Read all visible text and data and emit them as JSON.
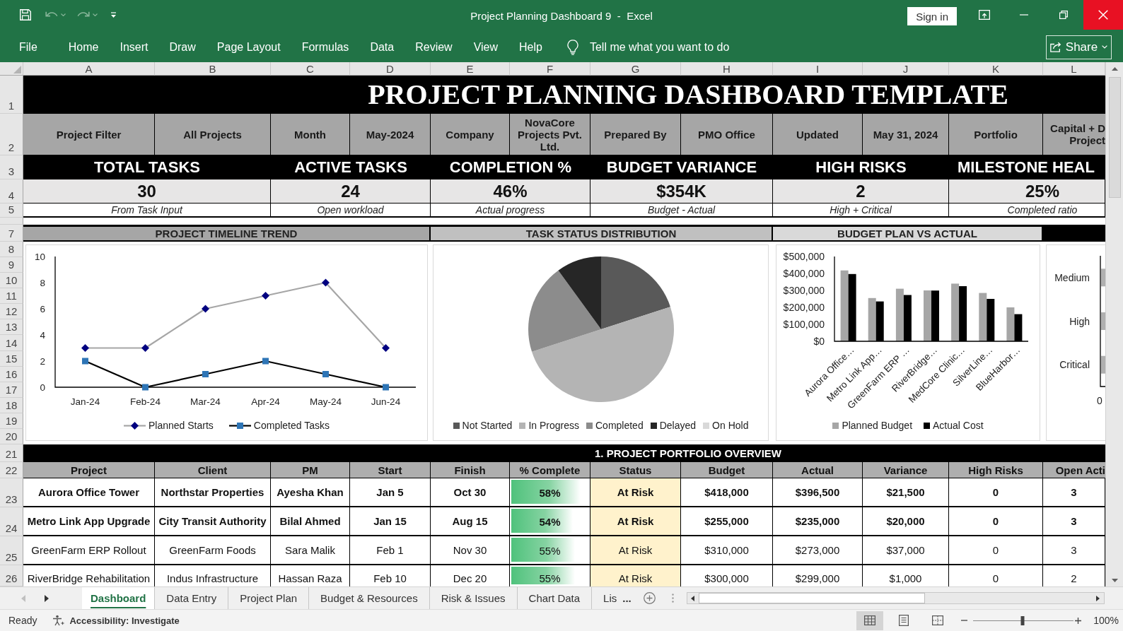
{
  "window": {
    "quick_access": [
      {
        "kind": "save",
        "disabled": false
      },
      {
        "kind": "undo",
        "disabled": true
      },
      {
        "kind": "redo",
        "disabled": true
      },
      {
        "kind": "customize",
        "disabled": false
      }
    ],
    "title": "Project Planning Dashboard 9  -  Excel",
    "sign_in": "Sign in"
  },
  "ribbon": {
    "tabs": [
      "File",
      "Home",
      "Insert",
      "Draw",
      "Page Layout",
      "Formulas",
      "Data",
      "Review",
      "View",
      "Help"
    ],
    "tell_me": {
      "placeholder": "Tell me what you want to do"
    },
    "share": "Share"
  },
  "sheet": {
    "columns": [
      "A",
      "B",
      "C",
      "D",
      "E",
      "F",
      "G",
      "H",
      "I",
      "J",
      "K",
      "L"
    ],
    "row_numbers": [
      "1",
      "2",
      "3",
      "4",
      "5",
      "7",
      "8",
      "9",
      "10",
      "11",
      "12",
      "13",
      "14",
      "15",
      "16",
      "17",
      "18",
      "19",
      "20",
      "21",
      "22",
      "23",
      "24",
      "25",
      "26"
    ],
    "title": "PROJECT PLANNING DASHBOARD TEMPLATE",
    "filters": [
      {
        "label": "Project Filter",
        "value": "All Projects"
      },
      {
        "label": "Month",
        "value": "May-2024"
      },
      {
        "label": "Company",
        "value": "NovaCore Projects Pvt. Ltd."
      },
      {
        "label": "Prepared By",
        "value": "PMO Office"
      },
      {
        "label": "Updated",
        "value": "May 31, 2024"
      },
      {
        "label": "Portfolio",
        "value": "Capital + D Project"
      }
    ],
    "kpis": [
      {
        "title": "TOTAL TASKS",
        "value": "30",
        "note": "From Task Input"
      },
      {
        "title": "ACTIVE TASKS",
        "value": "24",
        "note": "Open workload"
      },
      {
        "title": "COMPLETION %",
        "value": "46%",
        "note": "Actual progress"
      },
      {
        "title": "BUDGET VARIANCE",
        "value": "$354K",
        "note": "Budget - Actual"
      },
      {
        "title": "HIGH RISKS",
        "value": "2",
        "note": "High + Critical"
      },
      {
        "title": "MILESTONE HEAL",
        "value": "25%",
        "note": "Completed ratio"
      }
    ],
    "panels": [
      {
        "kind": "chart",
        "title": "PROJECT TIMELINE TREND",
        "chart_data": [
          {
            "type": "line",
            "categories": [
              "Jan-24",
              "Feb-24",
              "Mar-24",
              "Apr-24",
              "May-24",
              "Jun-24"
            ],
            "ylim": [
              0,
              10
            ],
            "yticks": [
              0,
              2,
              4,
              6,
              8,
              10
            ],
            "legend": "bottom",
            "series": [
              {
                "name": "Planned Starts",
                "color": "#a6a6a6",
                "marker": "diamond",
                "values": [
                  3,
                  3,
                  6,
                  7,
                  8,
                  3
                ]
              },
              {
                "name": "Completed Tasks",
                "color": "#000000",
                "marker": "square",
                "values": [
                  2,
                  0,
                  1,
                  2,
                  1,
                  0
                ]
              }
            ]
          }
        ]
      },
      {
        "kind": "pie",
        "title": "TASK STATUS DISTRIBUTION",
        "legend": [
          {
            "label": "Not Started",
            "color": "#595959"
          },
          {
            "label": "In Progress",
            "color": "#b4b4b4"
          },
          {
            "label": "Completed",
            "color": "#8c8c8c"
          },
          {
            "label": "Delayed",
            "color": "#262626"
          },
          {
            "label": "On Hold",
            "color": "#d9d9d9"
          }
        ]
      },
      {
        "kind": "chart",
        "title": "BUDGET PLAN VS ACTUAL",
        "chart_data": [
          {
            "type": "bar",
            "categories": [
              "Aurora Office…",
              "Metro Link App…",
              "GreenFarm ERP …",
              "RiverBridge…",
              "MedCore Clinic…",
              "SilverLine…",
              "BlueHarbor…"
            ],
            "ylim": [
              0,
              500000
            ],
            "yticks": [
              {
                "value": 0,
                "label": "$0"
              },
              {
                "value": 100000,
                "label": "$100,000"
              },
              {
                "value": 200000,
                "label": "$200,000"
              },
              {
                "value": 300000,
                "label": "$300,000"
              },
              {
                "value": 400000,
                "label": "$400,000"
              },
              {
                "value": 500000,
                "label": "$500,000"
              }
            ],
            "legend": "bottom",
            "series": [
              {
                "name": "Planned Budget",
                "color": "#a6a6a6",
                "values": [
                  418000,
                  255000,
                  310000,
                  300000,
                  340000,
                  285000,
                  200000
                ]
              },
              {
                "name": "Actual Cost",
                "color": "#000000",
                "values": [
                  396500,
                  235000,
                  273000,
                  299000,
                  325000,
                  250000,
                  160000
                ]
              }
            ]
          }
        ]
      },
      {
        "kind": "risk",
        "categories": [
          "Medium",
          "High",
          "Critical"
        ],
        "tick": "0"
      }
    ],
    "portfolio": {
      "title": "1. PROJECT PORTFOLIO OVERVIEW",
      "columns": [
        "Project",
        "Client",
        "PM",
        "Start",
        "Finish",
        "% Complete",
        "Status",
        "Budget",
        "Actual",
        "Variance",
        "High Risks",
        "Open Acti"
      ],
      "rows": [
        {
          "emphasized": true,
          "project": "Aurora Office Tower",
          "client": "Northstar Properties",
          "pm": "Ayesha Khan",
          "start": "Jan 5",
          "finish": "Oct 30",
          "complete": {
            "text": "58%",
            "level": 0.89
          },
          "status": {
            "text": "At Risk",
            "color": "#fff2cc"
          },
          "budget": "$418,000",
          "actual": "$396,500",
          "variance": "$21,500",
          "high_risks": "0",
          "column_12": "3"
        },
        {
          "emphasized": true,
          "project": "Metro Link App Upgrade",
          "client": "City Transit Authority",
          "pm": "Bilal Ahmed",
          "start": "Jan 15",
          "finish": "Aug 15",
          "complete": {
            "text": "54%",
            "level": 0.79
          },
          "status": {
            "text": "At Risk",
            "color": "#fff2cc"
          },
          "budget": "$255,000",
          "actual": "$235,000",
          "variance": "$20,000",
          "high_risks": "0",
          "column_12": "3"
        },
        {
          "emphasized": false,
          "project": "GreenFarm ERP Rollout",
          "client": "GreenFarm Foods",
          "pm": "Sara Malik",
          "start": "Feb 1",
          "finish": "Nov 30",
          "complete": {
            "text": "55%",
            "level": 0.82
          },
          "status": {
            "text": "At Risk",
            "color": "#fff2cc"
          },
          "budget": "$310,000",
          "actual": "$273,000",
          "variance": "$37,000",
          "high_risks": "0",
          "column_12": "3"
        },
        {
          "emphasized": false,
          "project": "RiverBridge Rehabilitation",
          "client": "Indus Infrastructure",
          "pm": "Hassan Raza",
          "start": "Feb 10",
          "finish": "Dec 20",
          "complete": {
            "text": "55%",
            "level": 0.82
          },
          "status": {
            "text": "At Risk",
            "color": "#fff2cc"
          },
          "budget": "$300,000",
          "actual": "$299,000",
          "variance": "$1,000",
          "high_risks": "0",
          "column_12": "2"
        }
      ]
    }
  },
  "sheet_tabs": {
    "nav": [
      {
        "kind": "previous",
        "disabled": true
      },
      {
        "kind": "next",
        "disabled": false
      }
    ],
    "tabs": [
      {
        "label": "Dashboard",
        "selected": true
      },
      {
        "label": "Data Entry",
        "selected": false
      },
      {
        "label": "Project Plan",
        "selected": false
      },
      {
        "label": "Budget & Resources",
        "selected": false
      },
      {
        "label": "Risk & Issues",
        "selected": false
      },
      {
        "label": "Chart Data",
        "selected": false
      },
      {
        "label": "Lis",
        "selected": false
      }
    ],
    "more": "..."
  },
  "status_bar": {
    "mode": "Ready",
    "accessibility": "Accessibility: Investigate",
    "views": [
      {
        "kind": "normal",
        "selected": true
      },
      {
        "kind": "page_layout",
        "selected": false
      },
      {
        "kind": "page_break",
        "selected": false
      }
    ],
    "zoom": {
      "level": 0.49,
      "text": "100%"
    }
  }
}
